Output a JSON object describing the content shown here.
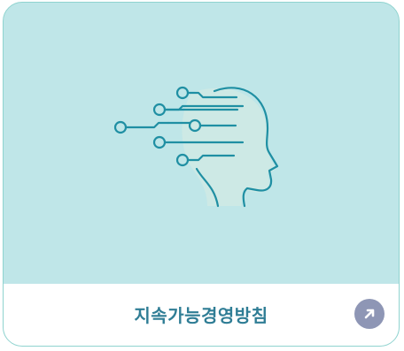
{
  "card": {
    "title": "지속가능경영방침",
    "icon": "ai-head-circuit-icon",
    "action_icon": "arrow-up-right-icon"
  },
  "colors": {
    "card_background": "#bfe6e8",
    "card_border": "#8fd3cf",
    "title_text": "#2f7d95",
    "line_art": "#1f8fa3",
    "head_fill": "#cfe9e4",
    "button_background": "#8e96b5"
  }
}
